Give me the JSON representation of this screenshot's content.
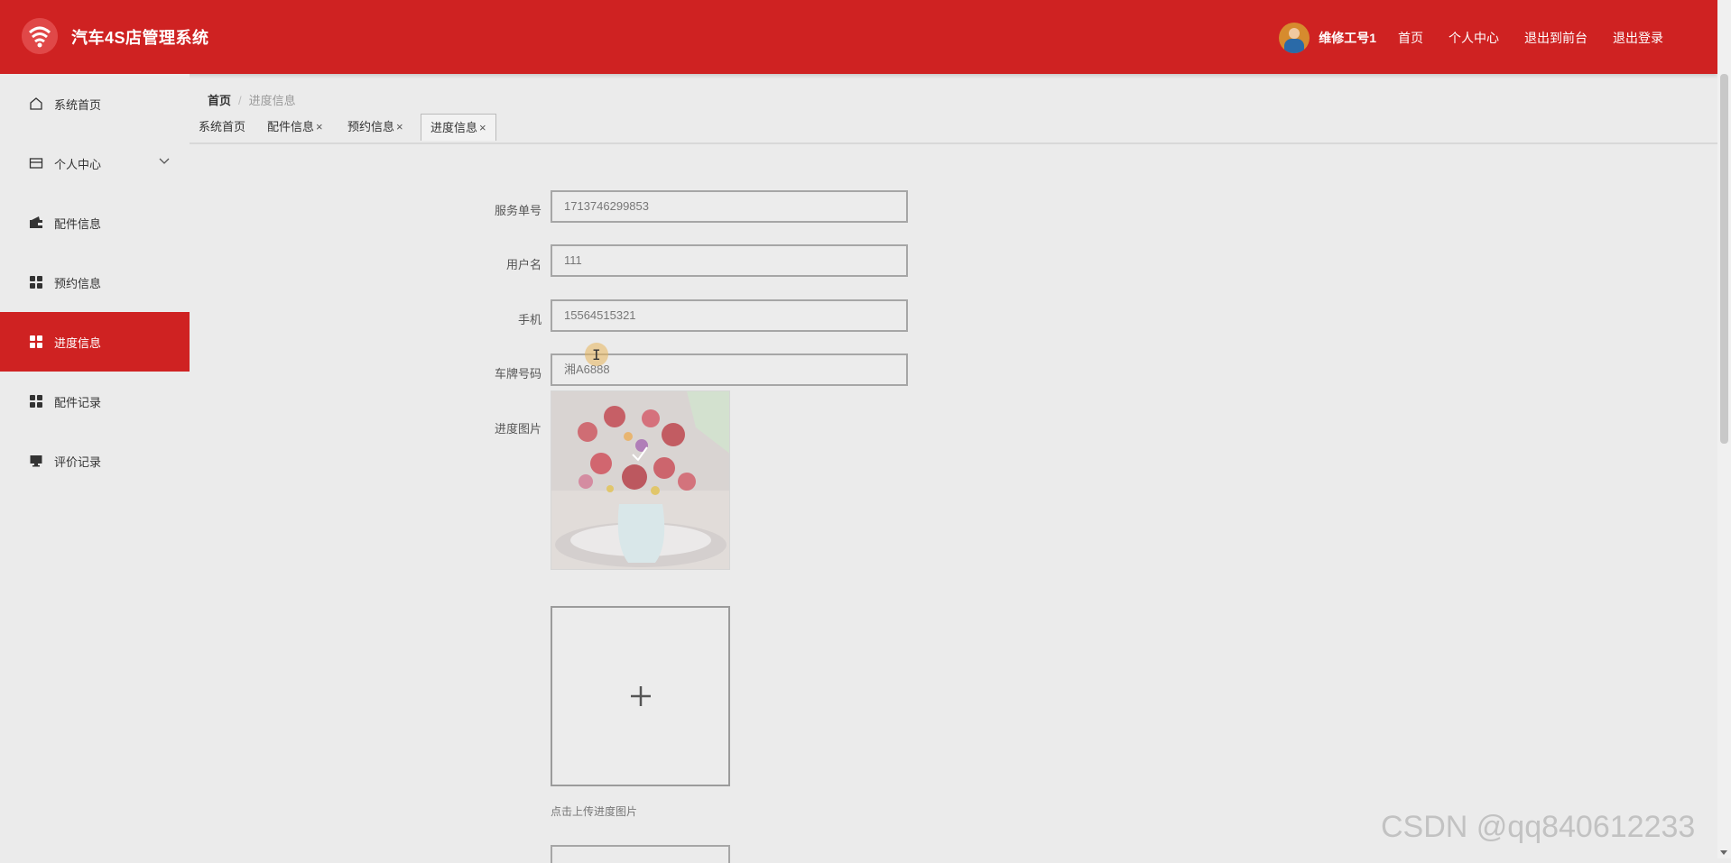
{
  "header": {
    "app_title": "汽车4S店管理系统",
    "username": "维修工号1",
    "links": [
      "首页",
      "个人中心",
      "退出到前台",
      "退出登录"
    ],
    "bg_color": "#cf2222"
  },
  "sidebar": {
    "items": [
      {
        "label": "系统首页",
        "icon": "home-icon"
      },
      {
        "label": "个人中心",
        "icon": "card-icon"
      },
      {
        "label": "配件信息",
        "icon": "wallet-icon"
      },
      {
        "label": "预约信息",
        "icon": "grid-icon"
      },
      {
        "label": "进度信息",
        "icon": "grid-icon",
        "active": true
      },
      {
        "label": "配件记录",
        "icon": "grid-icon"
      },
      {
        "label": "评价记录",
        "icon": "monitor-icon"
      }
    ]
  },
  "breadcrumb": {
    "home": "首页",
    "separator": "/",
    "current": "进度信息"
  },
  "tabs": [
    {
      "label": "系统首页",
      "closable": false
    },
    {
      "label": "配件信息",
      "closable": true
    },
    {
      "label": "预约信息",
      "closable": true
    },
    {
      "label": "进度信息",
      "closable": true,
      "active": true
    }
  ],
  "tab_close_glyph": "×",
  "form": {
    "service_no": {
      "label": "服务单号",
      "value": "1713746299853"
    },
    "username": {
      "label": "用户名",
      "value": "111"
    },
    "phone": {
      "label": "手机",
      "value": "15564515321"
    },
    "plate": {
      "label": "车牌号码",
      "value": "湘A6888"
    },
    "progress_image": {
      "label": "进度图片",
      "upload_hint": "点击上传进度图片"
    }
  },
  "watermark": "CSDN @qq840612233"
}
